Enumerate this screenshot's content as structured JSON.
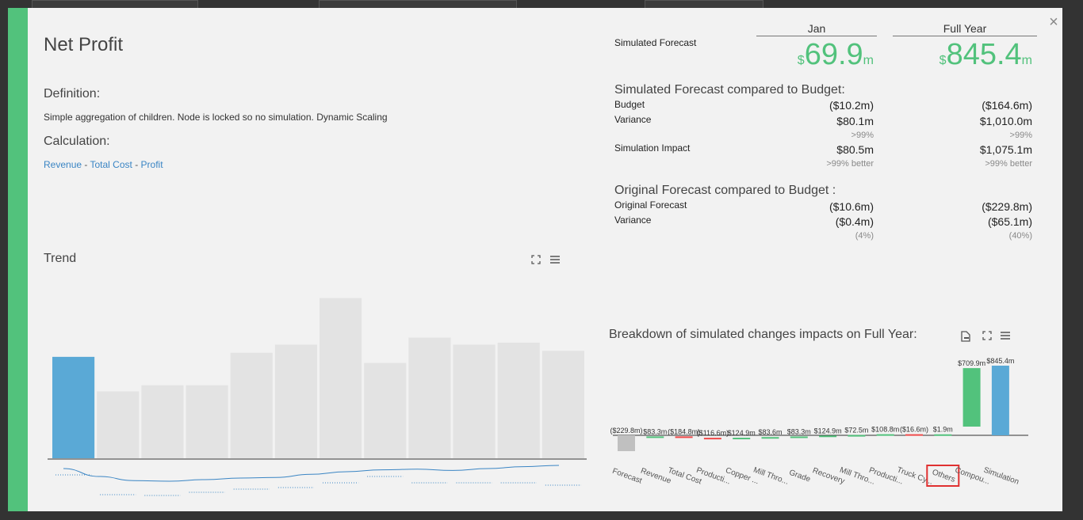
{
  "modal": {
    "title": "Net Profit",
    "definition_label": "Definition:",
    "definition_text": "Simple aggregation of children. Node is locked so no simulation. Dynamic Scaling",
    "calculation_label": "Calculation:",
    "calculation": {
      "link1": "Revenue",
      "sep1": " - ",
      "link2": "Total Cost",
      "sep2": " - ",
      "link3": "Profit"
    },
    "trend_title": "Trend",
    "close_glyph": "×"
  },
  "colors": {
    "accent": "#52c27c",
    "bar_blue": "#5aa9d6",
    "bar_gray": "#e3e3e3",
    "negative": "#f04a4a",
    "positive": "#52c27c"
  },
  "summary": {
    "simulated_forecast_label": "Simulated Forecast",
    "col_jan": "Jan",
    "col_full_year": "Full Year",
    "jan_currency": "$",
    "jan_value": "69.9",
    "jan_unit": "m",
    "fy_currency": "$",
    "fy_value": "845.4",
    "fy_unit": "m",
    "budget_section": "Simulated Forecast compared to Budget:",
    "budget_label": "Budget",
    "budget_jan": "($10.2m)",
    "budget_fy": "($164.6m)",
    "variance_label": "Variance",
    "variance_jan": "$80.1m",
    "variance_fy": "$1,010.0m",
    "variance_jan_pct": ">99%",
    "variance_fy_pct": ">99%",
    "sim_impact_label": "Simulation Impact",
    "sim_impact_jan": "$80.5m",
    "sim_impact_fy": "$1,075.1m",
    "sim_impact_jan_note": ">99% better",
    "sim_impact_fy_note": ">99% better",
    "original_section": "Original Forecast compared to Budget :",
    "orig_label": "Original Forecast",
    "orig_jan": "($10.6m)",
    "orig_fy": "($229.8m)",
    "orig_var_label": "Variance",
    "orig_var_jan": "($0.4m)",
    "orig_var_fy": "($65.1m)",
    "orig_var_jan_pct": "(4%)",
    "orig_var_fy_pct": "(40%)"
  },
  "trend_chart": {
    "type": "bar",
    "bar_values": [
      100,
      66,
      72,
      72,
      104,
      112,
      158,
      94,
      119,
      112,
      114,
      106
    ],
    "highlight_index": 0,
    "line_values": [
      0.9,
      0.65,
      0.52,
      0.5,
      0.55,
      0.6,
      0.62,
      0.72,
      0.8,
      0.86,
      0.88,
      0.84,
      0.9,
      0.96,
      1.0
    ]
  },
  "chart_data": {
    "type": "waterfall",
    "title": "Breakdown of simulated changes impacts on Full Year:",
    "categories": [
      "Forecast",
      "Revenue",
      "Total Cost",
      "Producti...",
      "Copper ...",
      "Mill Thro...",
      "Grade",
      "Recovery",
      "Mill Thro...",
      "Producti...",
      "Truck Cy...",
      "Others",
      "Compou...",
      "Simulation"
    ],
    "labels": [
      "($229.8m)",
      "$83.3m",
      "($184.8m)",
      "($116.6m)",
      "$124.9m",
      "$83.6m",
      "$83.3m",
      "$124.9m",
      "$72.5m",
      "$108.8m",
      "($16.6m)",
      "$1.9m",
      "$709.9m",
      "$845.4m"
    ],
    "values": [
      -229.8,
      83.3,
      -184.8,
      -116.6,
      124.9,
      83.6,
      83.3,
      124.9,
      72.5,
      108.8,
      -16.6,
      1.9,
      709.9,
      845.4
    ],
    "highlighted_category": "Others"
  }
}
